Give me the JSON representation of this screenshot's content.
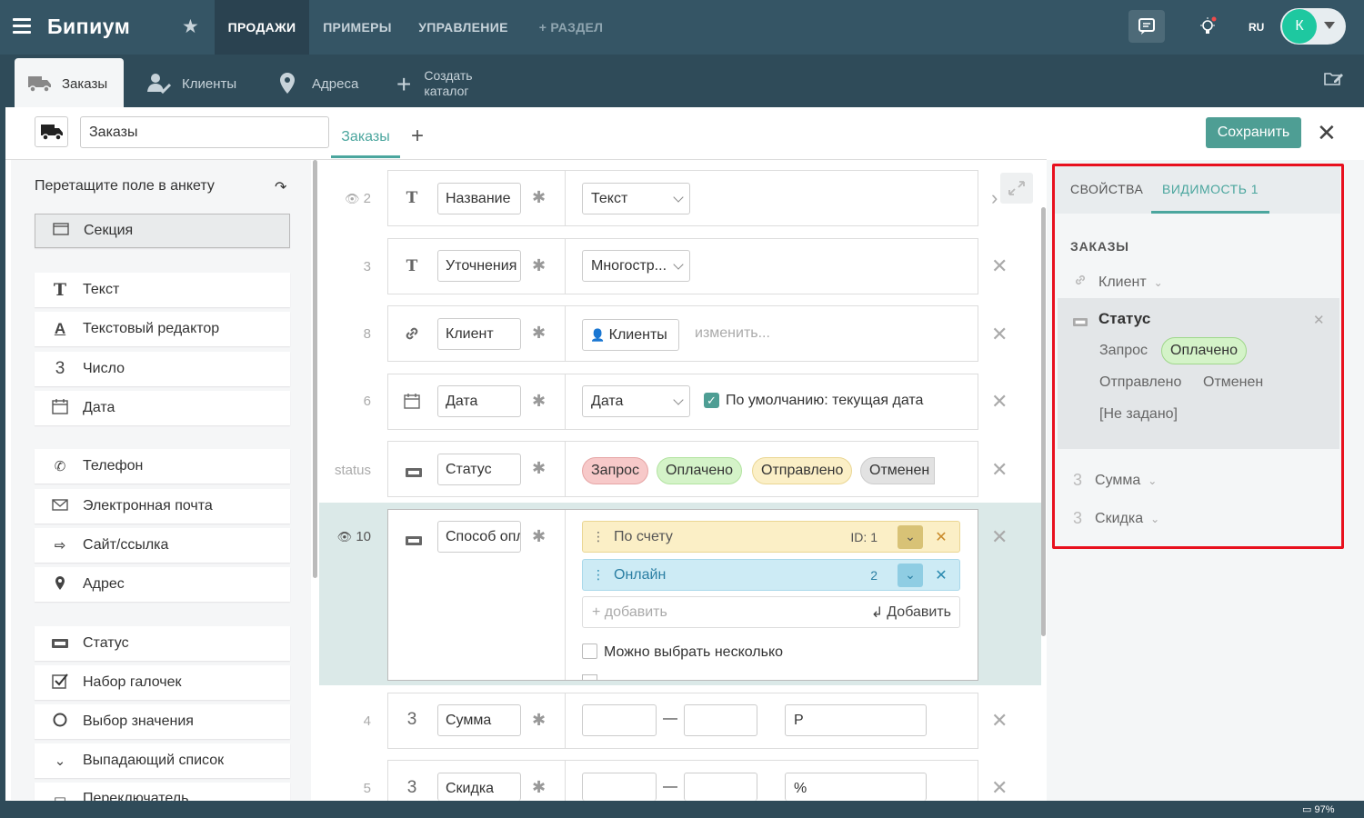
{
  "app": {
    "logo": "Бипиум",
    "lang": "RU",
    "user_initial": "К"
  },
  "nav": [
    "ПРОДАЖИ",
    "ПРИМЕРЫ",
    "УПРАВЛЕНИЕ",
    "+ РАЗДЕЛ"
  ],
  "subtabs": [
    "Заказы",
    "Клиенты",
    "Адреса",
    "Создать каталог"
  ],
  "header": {
    "catalog_name": "Заказы",
    "tab": "Заказы",
    "save": "Сохранить"
  },
  "palette": {
    "hint": "Перетащите поле в анкету",
    "section": "Секция",
    "items": [
      "Текст",
      "Текстовый редактор",
      "Число",
      "Дата",
      "Телефон",
      "Электронная почта",
      "Сайт/ссылка",
      "Адрес",
      "Статус",
      "Набор галочек",
      "Выбор значения",
      "Выпадающий список",
      "Переключатель"
    ]
  },
  "fields": {
    "r1": {
      "num": "2",
      "name": "Название",
      "type": "Текст"
    },
    "r2": {
      "num": "3",
      "name": "Уточнения",
      "type": "Многостр..."
    },
    "r3": {
      "num": "8",
      "name": "Клиент",
      "link": "Клиенты",
      "change": "изменить..."
    },
    "r4": {
      "num": "6",
      "name": "Дата",
      "type": "Дата",
      "default": "По умолчанию: текущая дата"
    },
    "r5": {
      "num": "status",
      "name": "Статус",
      "pills": [
        "Запрос",
        "Оплачено",
        "Отправлено",
        "Отменен"
      ]
    },
    "r6": {
      "num": "10",
      "name": "Способ оплаты",
      "opt1": {
        "label": "По счету",
        "id": "ID: 1"
      },
      "opt2": {
        "label": "Онлайн",
        "id": "2"
      },
      "add_placeholder": "+ добавить",
      "add_btn": "Добавить",
      "multi": "Можно выбрать несколько"
    },
    "r7": {
      "num": "4",
      "name": "Сумма",
      "dash": "—",
      "unit": "Р"
    },
    "r8": {
      "num": "5",
      "name": "Скидка",
      "dash": "—",
      "unit": "%"
    }
  },
  "right": {
    "tab_props": "СВОЙСТВА",
    "tab_vis": "ВИДИМОСТЬ 1",
    "section": "ЗАКАЗЫ",
    "client": "Клиент",
    "status": "Статус",
    "status_opts": [
      "Запрос",
      "Оплачено",
      "Отправлено",
      "Отменен",
      "[Не задано]"
    ],
    "sum": "Сумма",
    "discount": "Скидка"
  },
  "footer": {
    "battery": "97%"
  }
}
